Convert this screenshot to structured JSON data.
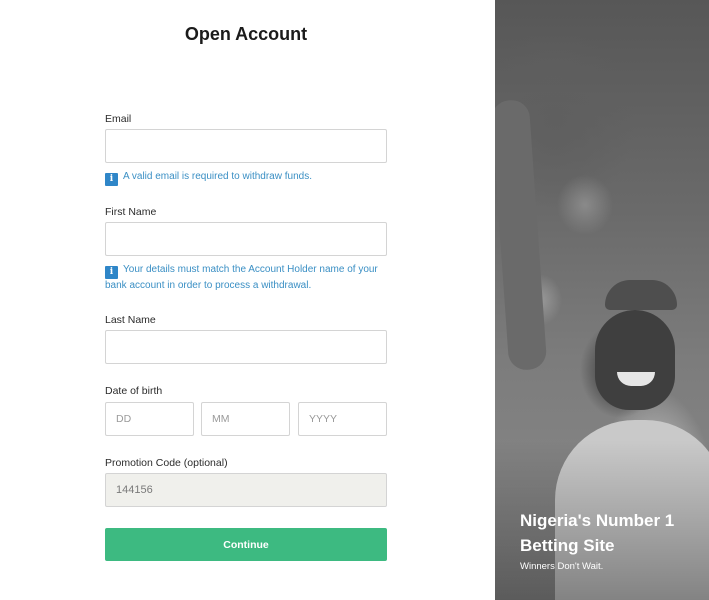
{
  "form": {
    "title": "Open Account",
    "email": {
      "label": "Email",
      "value": "",
      "info": "A valid email is required to withdraw funds."
    },
    "first_name": {
      "label": "First Name",
      "value": "",
      "info": "Your details must match the Account Holder name of your bank account in order to process a withdrawal."
    },
    "last_name": {
      "label": "Last Name",
      "value": ""
    },
    "date_of_birth": {
      "label": "Date of birth",
      "day_placeholder": "DD",
      "month_placeholder": "MM",
      "year_placeholder": "YYYY"
    },
    "promo_code": {
      "label": "Promotion Code (optional)",
      "value": "144156"
    },
    "continue_label": "Continue",
    "info_icon_glyph": "i"
  },
  "hero": {
    "title": "Nigeria's Number 1 Betting Site",
    "subtitle": "Winners Don't Wait."
  },
  "colors": {
    "accent_button": "#3dba81",
    "info_text": "#3a8fc4",
    "info_icon": "#2f86c8"
  },
  "icons": {
    "info": "info-icon"
  }
}
